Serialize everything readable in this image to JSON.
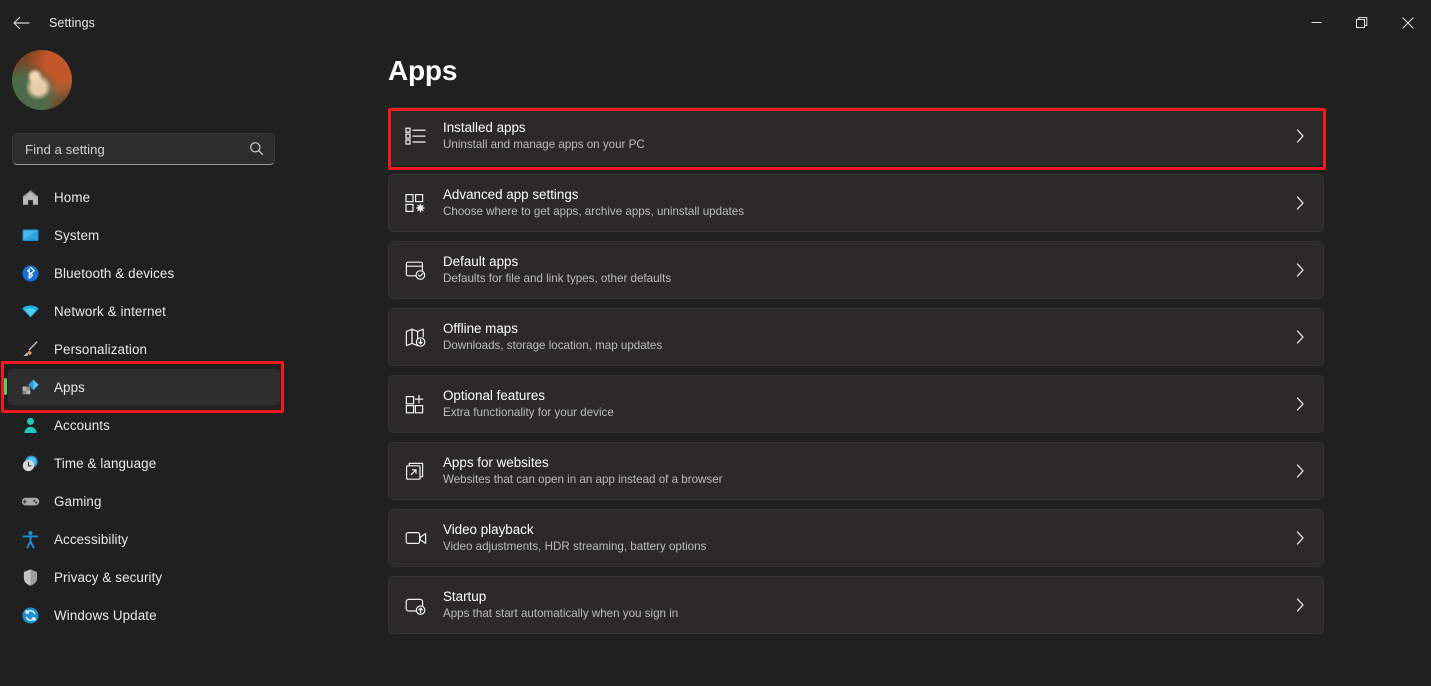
{
  "window": {
    "title": "Settings",
    "back_icon": "back-arrow-icon",
    "controls": [
      {
        "name": "minimize",
        "label": "Minimize"
      },
      {
        "name": "maximize",
        "label": "Restore"
      },
      {
        "name": "close",
        "label": "Close"
      }
    ]
  },
  "sidebar": {
    "avatar_label": "User account picture",
    "search": {
      "placeholder": "Find a setting",
      "value": "",
      "icon": "search-icon"
    },
    "items": [
      {
        "label": "Home",
        "icon": "home-icon",
        "selected": false
      },
      {
        "label": "System",
        "icon": "system-icon",
        "selected": false
      },
      {
        "label": "Bluetooth & devices",
        "icon": "bluetooth-icon",
        "selected": false
      },
      {
        "label": "Network & internet",
        "icon": "network-icon",
        "selected": false
      },
      {
        "label": "Personalization",
        "icon": "brush-icon",
        "selected": false
      },
      {
        "label": "Apps",
        "icon": "apps-icon",
        "selected": true
      },
      {
        "label": "Accounts",
        "icon": "accounts-icon",
        "selected": false
      },
      {
        "label": "Time & language",
        "icon": "clock-icon",
        "selected": false
      },
      {
        "label": "Gaming",
        "icon": "gamepad-icon",
        "selected": false
      },
      {
        "label": "Accessibility",
        "icon": "accessibility-icon",
        "selected": false
      },
      {
        "label": "Privacy & security",
        "icon": "shield-icon",
        "selected": false
      },
      {
        "label": "Windows Update",
        "icon": "update-icon",
        "selected": false
      }
    ]
  },
  "main": {
    "page_title": "Apps",
    "cards": [
      {
        "title": "Installed apps",
        "subtitle": "Uninstall and manage apps on your PC",
        "icon": "list-icon",
        "chevron": "chevron-right-icon",
        "highlighted": true
      },
      {
        "title": "Advanced app settings",
        "subtitle": "Choose where to get apps, archive apps, uninstall updates",
        "icon": "app-settings-icon",
        "chevron": "chevron-right-icon",
        "highlighted": false
      },
      {
        "title": "Default apps",
        "subtitle": "Defaults for file and link types, other defaults",
        "icon": "default-apps-icon",
        "chevron": "chevron-right-icon",
        "highlighted": false
      },
      {
        "title": "Offline maps",
        "subtitle": "Downloads, storage location, map updates",
        "icon": "map-icon",
        "chevron": "chevron-right-icon",
        "highlighted": false
      },
      {
        "title": "Optional features",
        "subtitle": "Extra functionality for your device",
        "icon": "grid-plus-icon",
        "chevron": "chevron-right-icon",
        "highlighted": false
      },
      {
        "title": "Apps for websites",
        "subtitle": "Websites that can open in an app instead of a browser",
        "icon": "external-link-icon",
        "chevron": "chevron-right-icon",
        "highlighted": false
      },
      {
        "title": "Video playback",
        "subtitle": "Video adjustments, HDR streaming, battery options",
        "icon": "video-camera-icon",
        "chevron": "chevron-right-icon",
        "highlighted": false
      },
      {
        "title": "Startup",
        "subtitle": "Apps that start automatically when you sign in",
        "icon": "startup-icon",
        "chevron": "chevron-right-icon",
        "highlighted": false
      }
    ]
  },
  "annotations": [
    {
      "name": "installed-apps-highlight",
      "color": "#f01b20"
    },
    {
      "name": "apps-nav-highlight",
      "color": "#f01b20"
    }
  ],
  "colors": {
    "page_background": "#202020",
    "card_background": "#2b2a28",
    "selected_nav_background": "#2e2e2e",
    "accent_indicator": "#4ad26b",
    "annotation_red": "#f01b20"
  }
}
